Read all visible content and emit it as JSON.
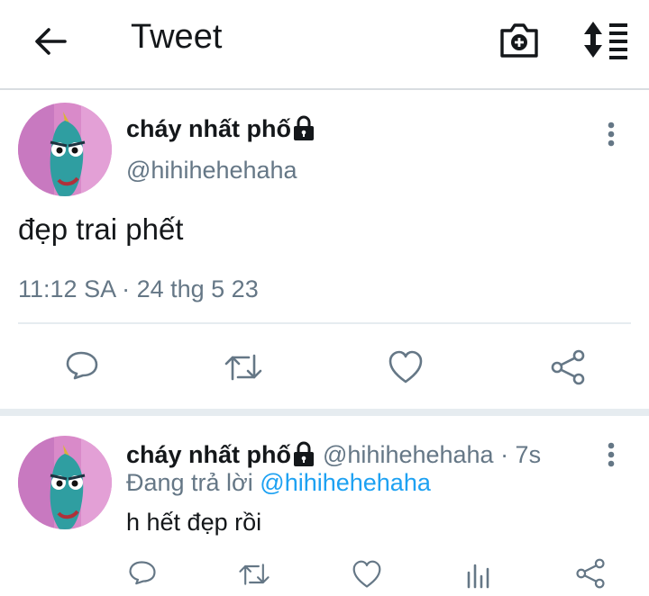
{
  "header": {
    "title": "Tweet"
  },
  "main_tweet": {
    "display_name": "cháy nhất phố",
    "handle": "@hihihehehaha",
    "text": "đẹp trai phết",
    "timestamp": "11:12 SA · 24 thg 5 23"
  },
  "reply_tweet": {
    "display_name": "cháy nhất phố",
    "handle_time": "@hihihehehaha · 7s",
    "replying_prefix": "Đang trả lời",
    "replying_to": "@hihihehehaha",
    "text": "h hết đẹp rồi"
  },
  "icons": {
    "header": [
      "back-arrow-icon",
      "camera-plus-icon",
      "sort-list-icon"
    ],
    "main_actions": [
      "reply-icon",
      "retweet-icon",
      "like-icon",
      "share-icon"
    ],
    "reply_actions": [
      "reply-icon",
      "retweet-icon",
      "like-icon",
      "analytics-icon",
      "share-icon"
    ],
    "badges": [
      "lock-icon",
      "more-vertical-icon"
    ]
  },
  "colors": {
    "text": "#14171a",
    "secondary": "#657786",
    "link": "#1da1f2",
    "separator": "#e6ecf0"
  }
}
